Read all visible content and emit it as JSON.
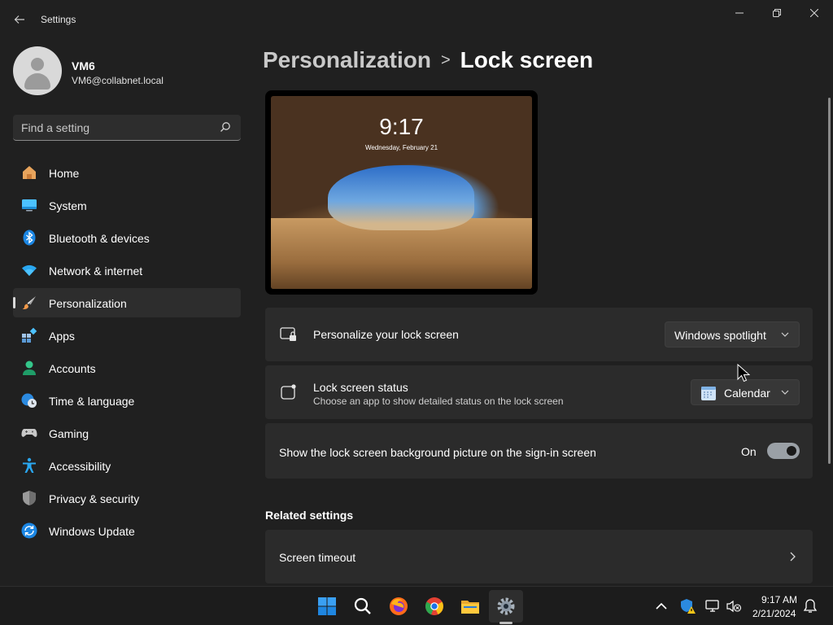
{
  "window": {
    "title": "Settings",
    "back_icon": "arrow-left-icon"
  },
  "profile": {
    "name": "VM6",
    "email": "VM6@collabnet.local"
  },
  "search": {
    "placeholder": "Find a setting",
    "value": ""
  },
  "sidebar": {
    "items": [
      {
        "label": "Home",
        "icon": "home-icon"
      },
      {
        "label": "System",
        "icon": "monitor-icon"
      },
      {
        "label": "Bluetooth & devices",
        "icon": "bluetooth-icon"
      },
      {
        "label": "Network & internet",
        "icon": "wifi-icon"
      },
      {
        "label": "Personalization",
        "icon": "paintbrush-icon",
        "active": true
      },
      {
        "label": "Apps",
        "icon": "apps-icon"
      },
      {
        "label": "Accounts",
        "icon": "person-icon"
      },
      {
        "label": "Time & language",
        "icon": "globe-clock-icon"
      },
      {
        "label": "Gaming",
        "icon": "gamepad-icon"
      },
      {
        "label": "Accessibility",
        "icon": "accessibility-icon"
      },
      {
        "label": "Privacy & security",
        "icon": "shield-icon"
      },
      {
        "label": "Windows Update",
        "icon": "sync-icon"
      }
    ]
  },
  "breadcrumb": {
    "parent": "Personalization",
    "separator": ">",
    "current": "Lock screen"
  },
  "preview": {
    "time": "9:17",
    "date": "Wednesday, February 21"
  },
  "settings": {
    "personalize": {
      "title": "Personalize your lock screen",
      "value": "Windows spotlight"
    },
    "status": {
      "title": "Lock screen status",
      "subtitle": "Choose an app to show detailed status on the lock screen",
      "value": "Calendar"
    },
    "signin_background": {
      "title": "Show the lock screen background picture on the sign-in screen",
      "state": "On",
      "on": true
    }
  },
  "related": {
    "heading": "Related settings",
    "items": [
      {
        "title": "Screen timeout"
      }
    ]
  },
  "taskbar": {
    "apps": [
      "windows-start-icon",
      "search-icon",
      "firefox-icon",
      "chrome-icon",
      "file-explorer-icon",
      "settings-gear-icon"
    ],
    "clock_time": "9:17 AM",
    "clock_date": "2/21/2024"
  },
  "colors": {
    "background": "#202020",
    "card": "#2b2b2b",
    "accent_blue": "#0078d4"
  }
}
